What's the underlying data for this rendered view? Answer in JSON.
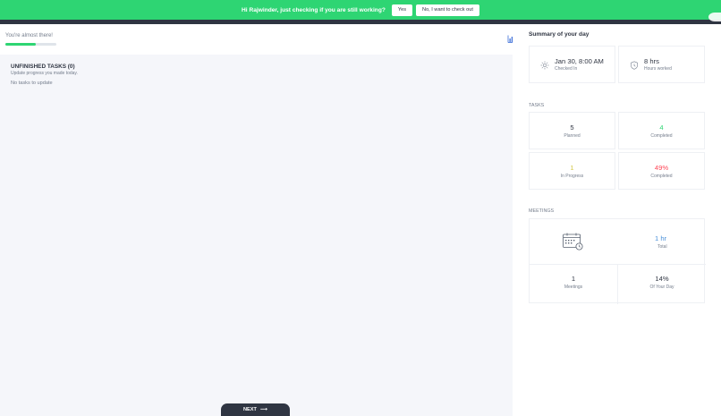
{
  "banner": {
    "message": "Hi Rajwinder, just checking if you are still working?",
    "yes_label": "Yes",
    "checkout_label": "No, I want to check out"
  },
  "progress": {
    "label": "You're almost there!",
    "fraction": 0.6
  },
  "unfinished": {
    "title": "UNFINISHED TASKS (0)",
    "subtitle": "Update progress you made today.",
    "empty_text": "No tasks to update"
  },
  "next_label": "NEXT",
  "next_arrow": "⟶",
  "summary": {
    "title": "Summary of your day",
    "checked_in_value": "Jan 30, 8:00 AM",
    "checked_in_label": "Checked In",
    "hours_value": "8 hrs",
    "hours_label": "Hours worked"
  },
  "tasks": {
    "section_label": "TASKS",
    "planned_value": "5",
    "planned_label": "Planned",
    "completed_value": "4",
    "completed_label": "Completed",
    "in_progress_value": "1",
    "in_progress_label": "In Progress",
    "pct_completed_value": "49%",
    "pct_completed_label": "Completed"
  },
  "meetings": {
    "section_label": "MEETINGS",
    "total_value": "1 hr",
    "total_label": "Total",
    "count_value": "1",
    "count_label": "Meetings",
    "share_value": "14%",
    "share_label": "Of Your Day"
  },
  "colors": {
    "banner_green": "#2ed573",
    "dark": "#2f3542",
    "completed_green": "#2ed573",
    "in_progress_yellow": "#d4c84a",
    "pct_red": "#ff4757",
    "total_blue": "#4a90d9"
  },
  "icons": {
    "checked_in": "sun-icon",
    "hours": "shield-clock-icon",
    "meetings": "calendar-clock-icon",
    "chart": "bar-chart-icon"
  }
}
